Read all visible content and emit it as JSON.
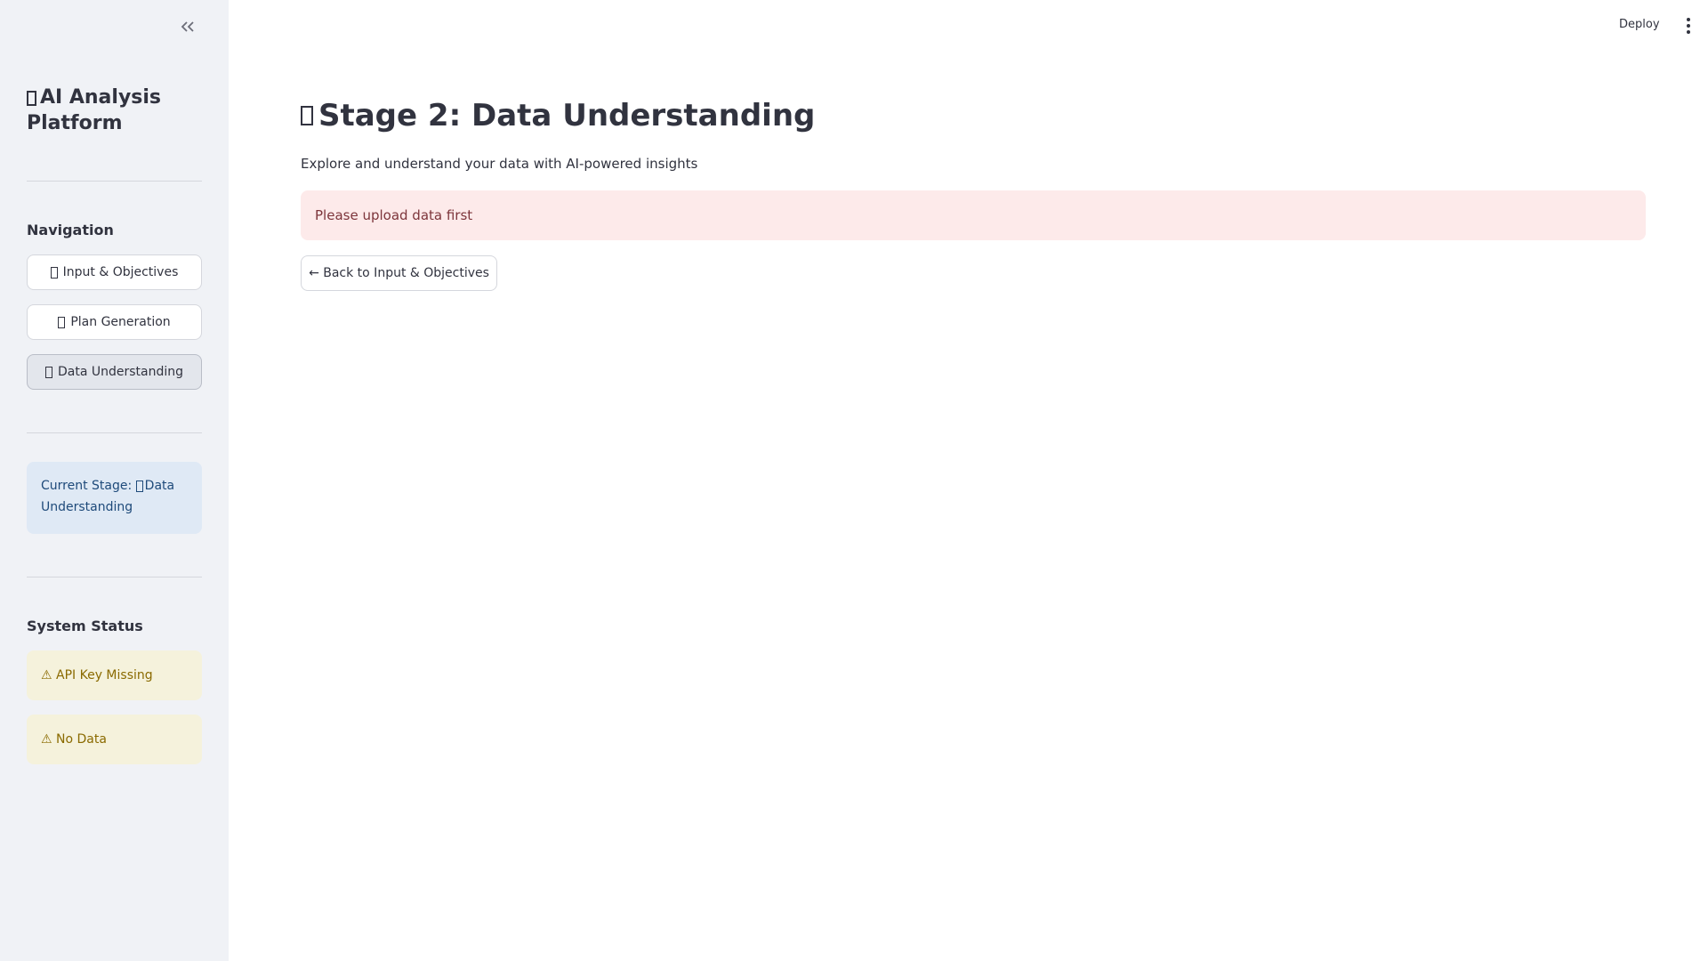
{
  "sidebar": {
    "title": "AI Analysis Platform",
    "navigation_label": "Navigation",
    "nav_items": [
      {
        "label": "Input & Objectives"
      },
      {
        "label": "Plan Generation"
      },
      {
        "label": "Data Understanding"
      }
    ],
    "current_stage_prefix": "Current Stage:",
    "current_stage_value": "Data Understanding",
    "system_status_label": "System Status",
    "status_items": [
      {
        "label": "⚠ API Key Missing"
      },
      {
        "label": "⚠ No Data"
      }
    ]
  },
  "header": {
    "deploy_label": "Deploy"
  },
  "main": {
    "title": "Stage 2: Data Understanding",
    "subtitle": "Explore and understand your data with AI-powered insights",
    "alert_text": "Please upload data first",
    "back_button_label": "← Back to Input & Objectives"
  },
  "icons": {
    "collapse": "double-chevron-left-icon",
    "menu": "vertical-dots-icon",
    "missing_glyph": "placeholder-glyph-icon"
  }
}
